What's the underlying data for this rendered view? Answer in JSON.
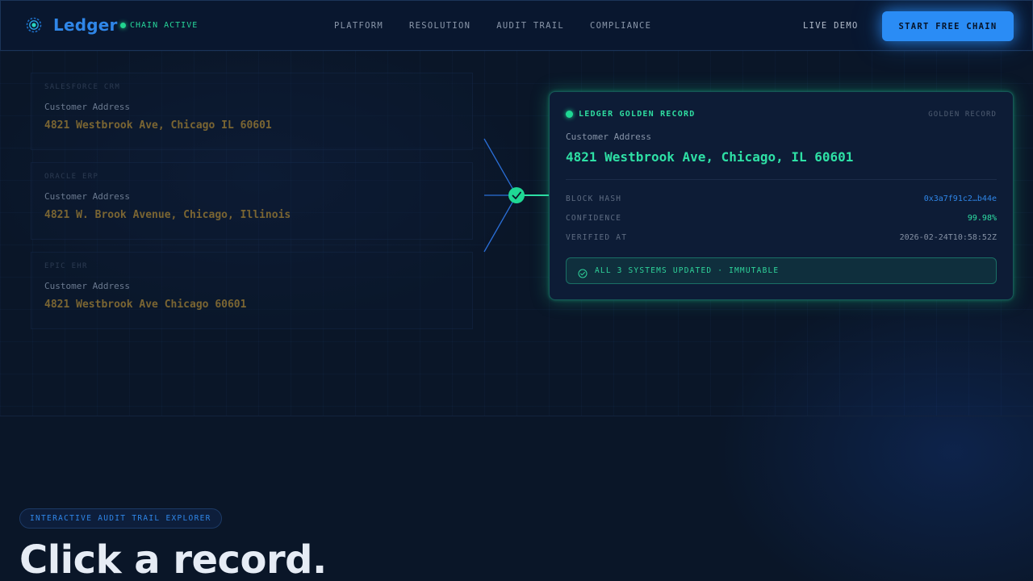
{
  "nav": {
    "brand": "Ledger",
    "chain_status": "CHAIN ACTIVE",
    "links": [
      "PLATFORM",
      "RESOLUTION",
      "AUDIT TRAIL",
      "COMPLIANCE"
    ],
    "live_demo": "LIVE DEMO",
    "cta": "START FREE CHAIN"
  },
  "sources": [
    {
      "system": "SALESFORCE CRM",
      "label": "Customer Address",
      "value": "4821 Westbrook Ave, Chicago IL 60601"
    },
    {
      "system": "ORACLE ERP",
      "label": "Customer Address",
      "value": "4821 W. Brook Avenue, Chicago, Illinois"
    },
    {
      "system": "EPIC EHR",
      "label": "Customer Address",
      "value": "4821 Westbrook Ave Chicago 60601"
    }
  ],
  "golden": {
    "title": "LEDGER GOLDEN RECORD",
    "tag": "GOLDEN RECORD",
    "label": "Customer Address",
    "value": "4821 Westbrook Ave, Chicago, IL 60601",
    "meta": [
      {
        "key": "BLOCK HASH",
        "value": "0x3a7f91c2…b44e"
      },
      {
        "key": "CONFIDENCE",
        "value": "99.98%"
      },
      {
        "key": "VERIFIED AT",
        "value": "2026-02-24T10:58:52Z"
      }
    ],
    "update": "ALL 3 SYSTEMS UPDATED · IMMUTABLE"
  },
  "explorer": {
    "pill": "INTERACTIVE AUDIT TRAIL EXPLORER",
    "title": "Click a record."
  },
  "colors": {
    "accent_blue": "#2a8cf5",
    "accent_green": "#22d48f",
    "background": "#0a1628"
  },
  "icons": {
    "logo": "gear-network-icon",
    "merge_check": "check-icon",
    "update_check": "circle-check-icon"
  }
}
